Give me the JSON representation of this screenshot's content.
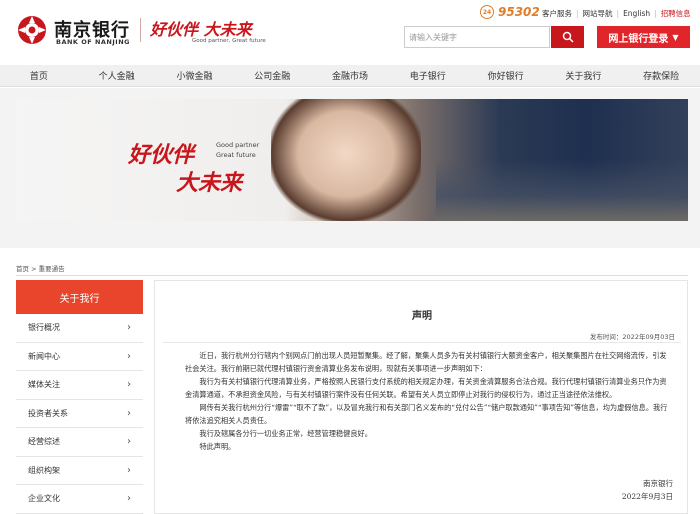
{
  "header": {
    "bank_name_cn": "南京银行",
    "bank_name_en": "BANK OF NANJING",
    "slogan_cn": "好伙伴 大未来",
    "slogan_en": "Good partner, Great future",
    "hotline": "95302",
    "links": [
      "客户服务",
      "网站导航",
      "English",
      "招聘信息"
    ],
    "search_placeholder": "请输入关键字",
    "login_label": "网上银行登录"
  },
  "nav": [
    "首页",
    "个人金融",
    "小微金融",
    "公司金融",
    "金融市场",
    "电子银行",
    "你好银行",
    "关于我行",
    "存款保险"
  ],
  "banner": {
    "slogan_line1": "好伙伴",
    "slogan_line2": "大未来",
    "en_line1": "Good partner",
    "en_line2": "Great future"
  },
  "breadcrumb": "首页 > 重要通告",
  "sidebar": {
    "title": "关于我行",
    "items": [
      "银行概况",
      "新闻中心",
      "媒体关注",
      "投资者关系",
      "经营综述",
      "组织构架",
      "企业文化"
    ]
  },
  "article": {
    "title": "声明",
    "date": "发布时间：2022年09月03日",
    "paragraphs": [
      "近日，我行杭州分行辖内个别网点门前出现人员短暂聚集。经了解，聚集人员多为有关村镇银行大额资金客户，相关聚集图片在社交网络流传，引发社会关注。我行前期已就代理村镇银行资金清算业务发布说明，现就有关事项进一步声明如下：",
      "我行为有关村镇银行代理清算业务，严格按照人民银行支付系统的相关规定办理，有关资金清算服务合法合规。我行代理村镇银行清算业务只作为资金清算通道，不承担资金风险，与有关村镇银行案件没有任何关联。希望有关人员立即停止对我行的侵权行为，通过正当途径依法维权。",
      "网传有关我行杭州分行“爆雷”“取不了款”，以及冒充我行和有关部门名义发布的“兑付公告”“储户取款通知”“事项告知”等信息，均为虚假信息。我行将依法追究相关人员责任。",
      "我行及辖属各分行一切业务正常，经营管理稳健良好。",
      "特此声明。"
    ],
    "signature": "南京银行",
    "sign_date": "2022年9月3日"
  }
}
